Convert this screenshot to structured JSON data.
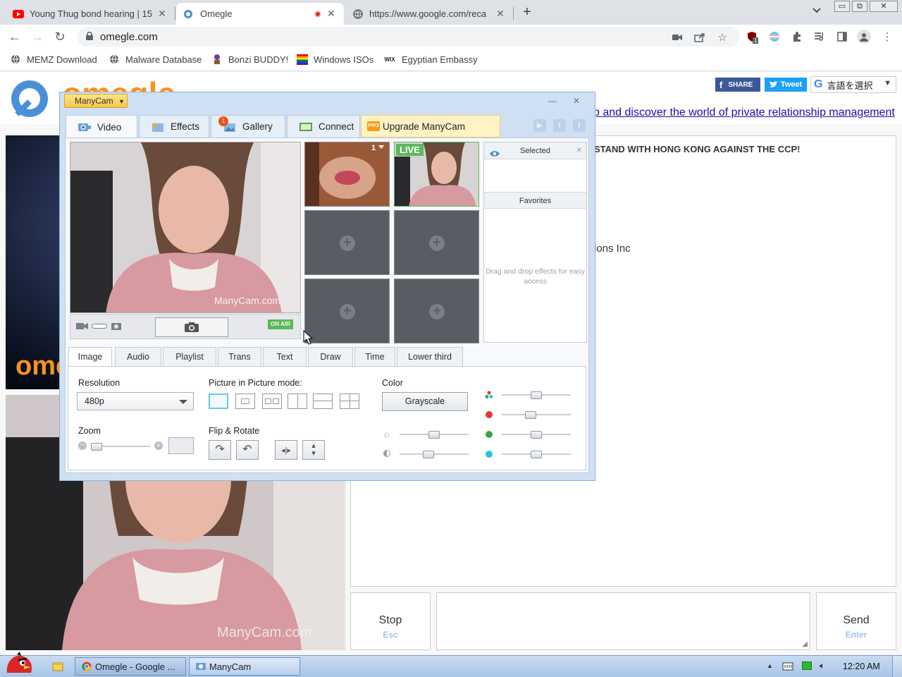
{
  "browser": {
    "tabs": [
      {
        "title": "Young Thug bond hearing | 15",
        "icon": "youtube-icon"
      },
      {
        "title": "Omegle",
        "icon": "omegle-icon",
        "recording": true
      },
      {
        "title": "https://www.google.com/reca",
        "icon": "globe-icon"
      }
    ],
    "close_glyph": "✕",
    "new_tab_glyph": "+",
    "url": "omegle.com",
    "bookmarks": [
      {
        "label": "MEMZ Download",
        "icon": "globe-icon"
      },
      {
        "label": "Malware Database",
        "icon": "globe-icon"
      },
      {
        "label": "Bonzi BUDDY!",
        "icon": "bonzi-icon"
      },
      {
        "label": "Windows ISOs",
        "icon": "windows-flag-icon"
      },
      {
        "label": "Egyptian Embassy",
        "icon": "wix-icon"
      }
    ],
    "wix_text": "WIX",
    "extension_badge": "1"
  },
  "page": {
    "logo_text": "omegle",
    "share_label": "SHARE",
    "tweet_label": "Tweet",
    "translate_label": "言語を選択",
    "tagline": "p and discover the world of private relationship management",
    "chat_banner": "STAND WITH HONG KONG AGAINST THE CCP!",
    "chat_line": "ions Inc",
    "stop_label": "Stop",
    "stop_key": "Esc",
    "send_label": "Send",
    "send_key": "Enter",
    "watermark": "ManyCam.com"
  },
  "manycam": {
    "title": "ManyCam",
    "tabs": [
      {
        "label": "Video"
      },
      {
        "label": "Effects"
      },
      {
        "label": "Gallery",
        "badge": "1"
      },
      {
        "label": "Connect"
      }
    ],
    "upgrade_label": "Upgrade ManyCam",
    "pro_badge": "PRO",
    "social": [
      "▶",
      "t",
      "f"
    ],
    "preview_watermark": "ManyCam.com",
    "on_air": "ON AIR",
    "thumb1_number": "1",
    "live_label": "LIVE",
    "side": {
      "selected": "Selected",
      "favorites": "Favorites",
      "hint": "Drag and drop effects for easy access"
    },
    "subtabs": [
      "Image",
      "Audio",
      "Playlist",
      "Trans",
      "Text",
      "Draw",
      "Time",
      "Lower third"
    ],
    "panel": {
      "resolution_label": "Resolution",
      "resolution_value": "480p",
      "pip_label": "Picture in Picture mode:",
      "color_label": "Color",
      "grayscale_label": "Grayscale",
      "zoom_label": "Zoom",
      "flip_label": "Flip & Rotate"
    },
    "sliders": {
      "saturation": 0.5,
      "red": 0.4,
      "green": 0.5,
      "blue": 0.5,
      "brightness": 0.5,
      "contrast": 0.4,
      "zoom": 0.0
    },
    "colors": {
      "red": "#e53935",
      "green": "#43a047",
      "blue": "#26c6da"
    }
  },
  "taskbar": {
    "items": [
      {
        "label": "Omegle - Google ..."
      },
      {
        "label": "ManyCam"
      }
    ],
    "clock": "12:20 AM"
  }
}
